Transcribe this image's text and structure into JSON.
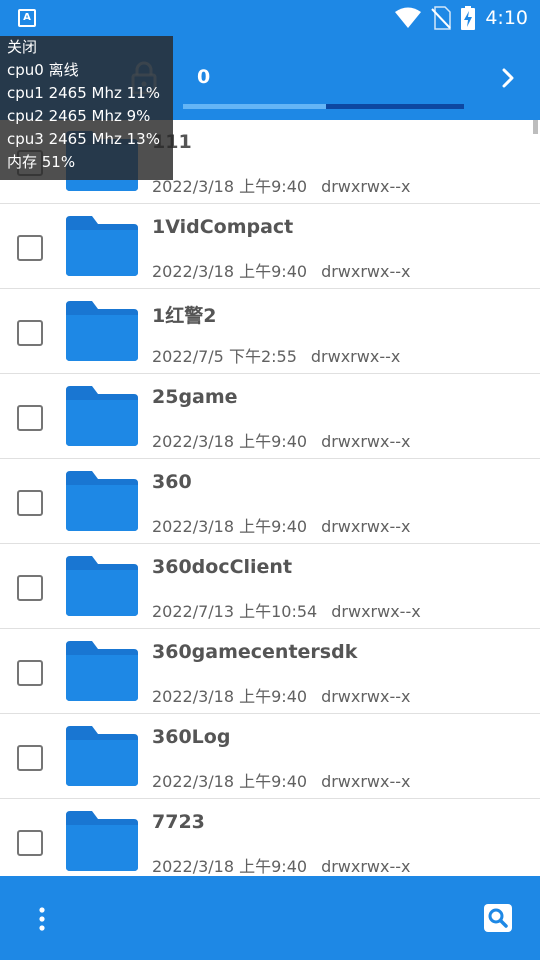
{
  "status_bar": {
    "app_icon_letter": "A",
    "time": "4:10"
  },
  "app_bar": {
    "path_label": "0",
    "progress_percent": 51
  },
  "files": [
    {
      "name": "111",
      "date": "2022/3/18 上午9:40",
      "perm": "drwxrwx--x"
    },
    {
      "name": "1VidCompact",
      "date": "2022/3/18 上午9:40",
      "perm": "drwxrwx--x"
    },
    {
      "name": "1红警2",
      "date": "2022/7/5 下午2:55",
      "perm": "drwxrwx--x"
    },
    {
      "name": "25game",
      "date": "2022/3/18 上午9:40",
      "perm": "drwxrwx--x"
    },
    {
      "name": "360",
      "date": "2022/3/18 上午9:40",
      "perm": "drwxrwx--x"
    },
    {
      "name": "360docClient",
      "date": "2022/7/13 上午10:54",
      "perm": "drwxrwx--x"
    },
    {
      "name": "360gamecentersdk",
      "date": "2022/3/18 上午9:40",
      "perm": "drwxrwx--x"
    },
    {
      "name": "360Log",
      "date": "2022/3/18 上午9:40",
      "perm": "drwxrwx--x"
    },
    {
      "name": "7723",
      "date": "2022/3/18 上午9:40",
      "perm": "drwxrwx--x"
    }
  ],
  "cpu_overlay": {
    "close_label": "关闭",
    "lines": [
      "cpu0 离线",
      "cpu1 2465 Mhz  11%",
      "cpu2 2465 Mhz  9%",
      "cpu3 2465 Mhz  13%",
      "内存 51%"
    ]
  },
  "colors": {
    "primary": "#1e88e5",
    "folder": "#1976d2"
  },
  "icons": {
    "lock": "lock-icon",
    "next": "chevron-right-icon",
    "menu": "more-vert-icon",
    "search": "search-icon",
    "folder": "folder-icon"
  }
}
